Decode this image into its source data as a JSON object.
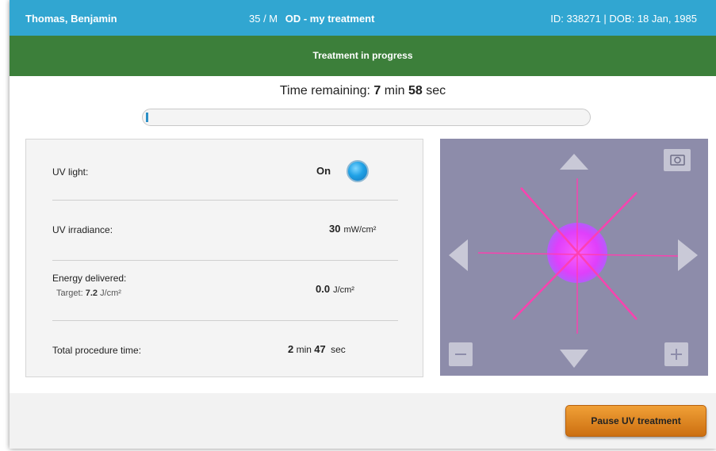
{
  "header": {
    "patient_name": "Thomas, Benjamin",
    "age_sex": "35 / M",
    "eye_treatment": "OD - my treatment",
    "id_dob": "ID: 338271 | DOB: 18 Jan, 1985"
  },
  "status": {
    "label": "Treatment in progress",
    "color": "#3c7f3a"
  },
  "timer": {
    "prefix": "Time remaining:",
    "minutes": "7",
    "min_label": "min",
    "seconds": "58",
    "sec_label": "sec",
    "progress_fraction": 0.005
  },
  "metrics": {
    "uv_light": {
      "label": "UV light:",
      "value": "On",
      "indicator_color": "#20a2e6"
    },
    "uv_irradiance": {
      "label": "UV irradiance:",
      "value": "30",
      "unit": "mW/cm²"
    },
    "energy_delivered": {
      "label": "Energy delivered:",
      "target_prefix": "Target:",
      "target_value": "7.2",
      "target_unit": "J/cm²",
      "value": "0.0",
      "unit": "J/cm²"
    },
    "total_procedure_time": {
      "label": "Total procedure time:",
      "minutes": "2",
      "min_label": "min",
      "seconds": "47",
      "sec_label": "sec"
    }
  },
  "camera_view": {
    "controls": [
      "camera-icon",
      "arrow-up-icon",
      "arrow-down-icon",
      "arrow-left-icon",
      "arrow-right-icon",
      "zoom-out-icon",
      "zoom-in-icon"
    ],
    "spot_color": "#e43bff"
  },
  "footer": {
    "pause_button": "Pause UV treatment",
    "button_color": "#e08a25"
  }
}
